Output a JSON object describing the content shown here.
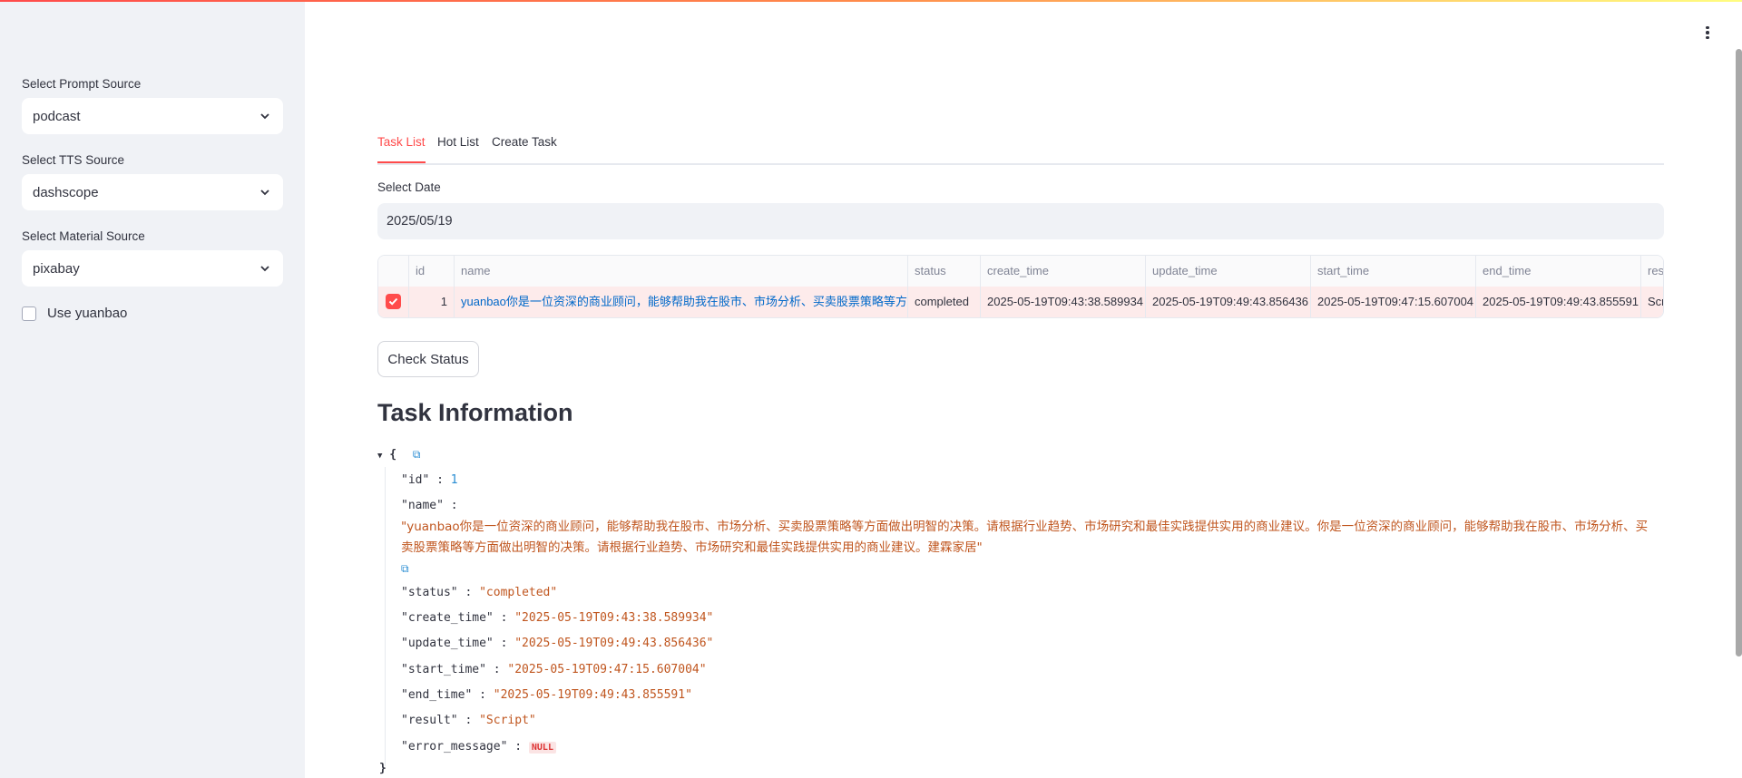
{
  "sidebar": {
    "prompt_label": "Select Prompt Source",
    "prompt_value": "podcast",
    "tts_label": "Select TTS Source",
    "tts_value": "dashscope",
    "material_label": "Select Material Source",
    "material_value": "pixabay",
    "yuanbao_label": "Use yuanbao"
  },
  "tabs": [
    "Task List",
    "Hot List",
    "Create Task"
  ],
  "date": {
    "label": "Select Date",
    "value": "2025/05/19"
  },
  "table": {
    "columns": [
      "id",
      "name",
      "status",
      "create_time",
      "update_time",
      "start_time",
      "end_time",
      "res"
    ],
    "row": {
      "id": "1",
      "name": "yuanbao你是一位资深的商业顾问，能够帮助我在股市、市场分析、买卖股票策略等方面做出明智的决策。",
      "status": "completed",
      "create_time": "2025-05-19T09:43:38.589934",
      "update_time": "2025-05-19T09:49:43.856436",
      "start_time": "2025-05-19T09:47:15.607004",
      "end_time": "2025-05-19T09:49:43.855591",
      "result": "Scr"
    }
  },
  "check_button": "Check Status",
  "section_title": "Task Information",
  "json_view": {
    "open": "{",
    "close": "}",
    "colon": ":",
    "id_key": "\"id\"",
    "id_val": "1",
    "name_key": "\"name\"",
    "name_val": "\"yuanbao你是一位资深的商业顾问，能够帮助我在股市、市场分析、买卖股票策略等方面做出明智的决策。请根据行业趋势、市场研究和最佳实践提供实用的商业建议。你是一位资深的商业顾问，能够帮助我在股市、市场分析、买卖股票策略等方面做出明智的决策。请根据行业趋势、市场研究和最佳实践提供实用的商业建议。建霖家居\"",
    "status_key": "\"status\"",
    "status_val": "\"completed\"",
    "create_key": "\"create_time\"",
    "create_val": "\"2025-05-19T09:43:38.589934\"",
    "update_key": "\"update_time\"",
    "update_val": "\"2025-05-19T09:49:43.856436\"",
    "start_key": "\"start_time\"",
    "start_val": "\"2025-05-19T09:47:15.607004\"",
    "end_key": "\"end_time\"",
    "end_val": "\"2025-05-19T09:49:43.855591\"",
    "result_key": "\"result\"",
    "result_val": "\"Script\"",
    "error_key": "\"error_message\"",
    "error_val": "NULL"
  },
  "colors": {
    "accent": "#ff4b4b",
    "link": "#0068c9",
    "sidebar_bg": "#f0f2f6",
    "json_string": "#c0561f"
  }
}
